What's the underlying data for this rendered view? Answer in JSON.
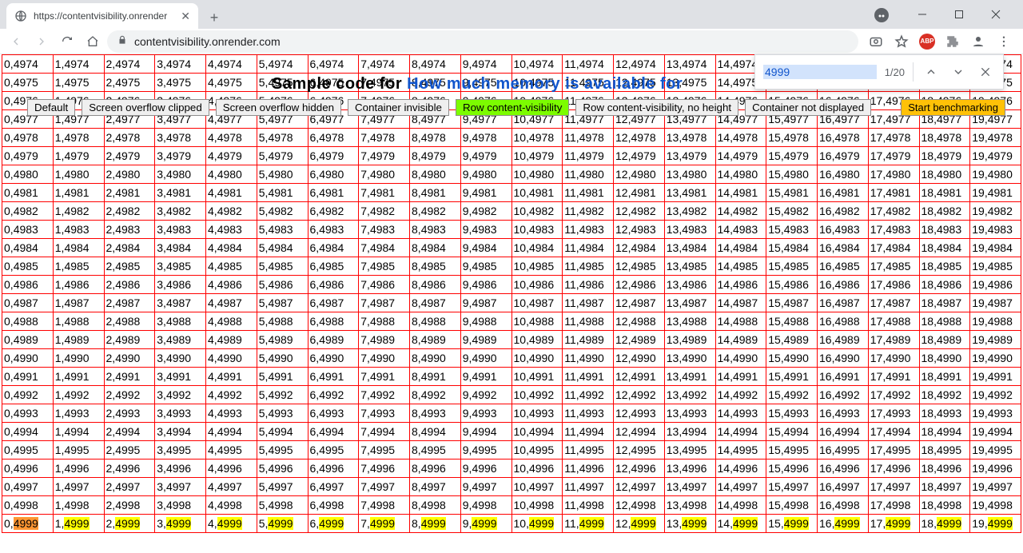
{
  "chrome": {
    "tab_title": "https://contentvisibility.onrender",
    "url_display": "contentvisibility.onrender.com",
    "window_controls": {
      "min": "–",
      "max": "▢",
      "close": "✕"
    }
  },
  "find": {
    "query": "4999",
    "count_label": "1/20"
  },
  "heading": {
    "text_prefix": "Sample code for ",
    "link_text": "How much memory is available for"
  },
  "controls": [
    {
      "label": "Default",
      "active": false
    },
    {
      "label": "Screen overflow clipped",
      "active": false
    },
    {
      "label": "Screen overflow hidden",
      "active": false
    },
    {
      "label": "Container invisible",
      "active": false
    },
    {
      "label": "Row content-visibility",
      "active": true
    },
    {
      "label": "Row content-visibility, no height",
      "active": false
    },
    {
      "label": "Container not displayed",
      "active": false
    }
  ],
  "start_label": "Start benchmarking",
  "grid": {
    "cols": 20,
    "row_start": 4974,
    "row_end": 4999,
    "highlight_row": 4999,
    "active_col": 0
  }
}
